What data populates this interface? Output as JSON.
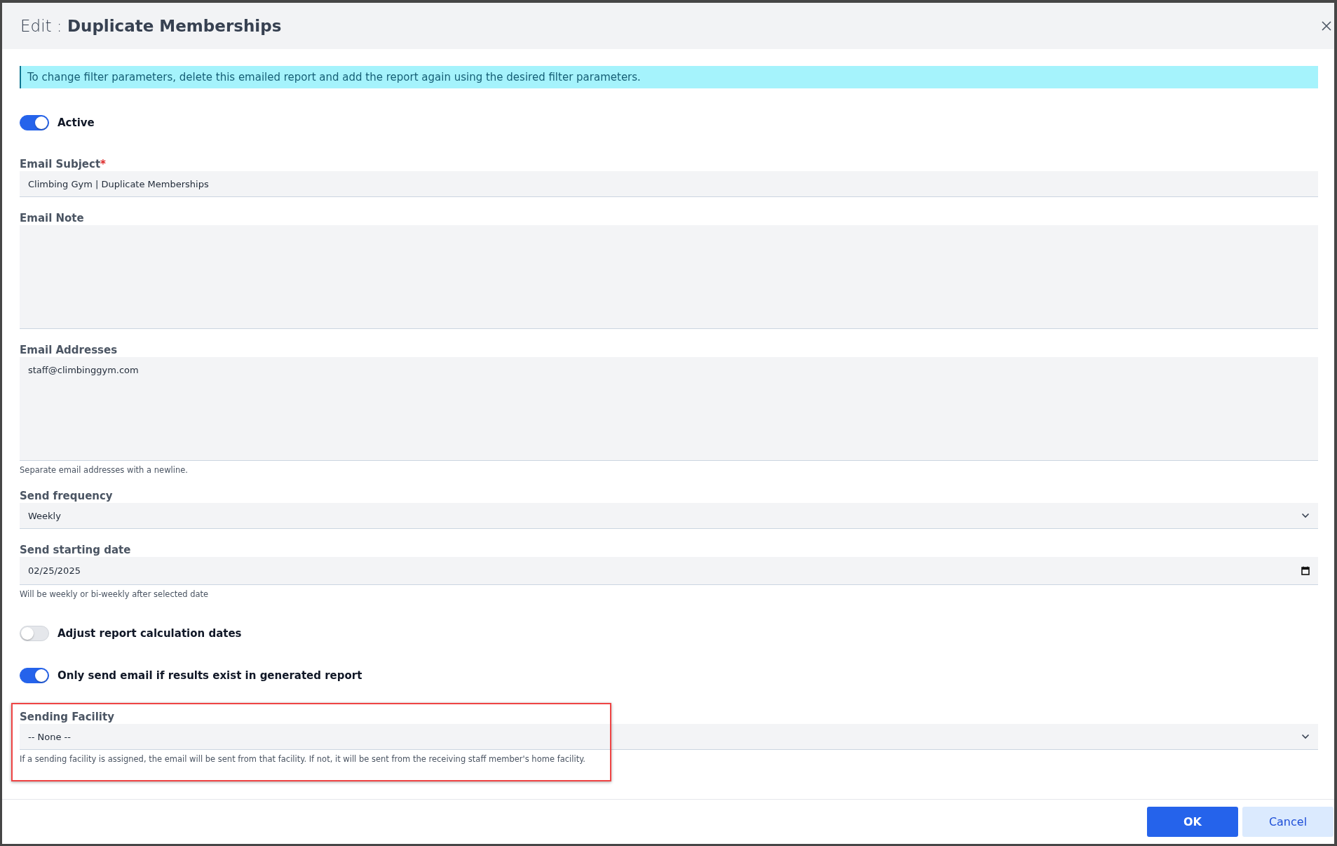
{
  "dialog": {
    "title": "Edit : **Duplicate Memberships**"
  },
  "notice": "To change filter parameters, delete this emailed report and add the report again using the desired filter parameters.",
  "fields": [
    {
      "kind": "toggle",
      "label": "Active",
      "on": true
    },
    {
      "kind": "text",
      "label": "Email Subject",
      "required_mark": "*",
      "value": "Climbing Gym | Duplicate Memberships"
    },
    {
      "kind": "textarea",
      "label": "Email Note"
    },
    {
      "kind": "textarea",
      "label": "Email Addresses",
      "value": "staff@climbinggym.com",
      "hint": "Separate email addresses with a newline."
    },
    {
      "kind": "select",
      "label": "Send frequency",
      "value": "Weekly"
    },
    {
      "kind": "date",
      "label": "Send starting date",
      "value": "02/25/2025",
      "hint": "Will be weekly or bi-weekly after selected date"
    },
    {
      "kind": "toggle",
      "label": "Adjust report calculation dates",
      "on": false
    },
    {
      "kind": "toggle",
      "label": "Only send email if results exist in generated report",
      "on": true
    },
    {
      "kind": "select",
      "label": "Sending Facility",
      "value": "-- None --",
      "hint": "If a sending facility is assigned, the email will be sent from that facility. If not, it will be sent from the receiving staff member's home facility.",
      "highlighted": true
    }
  ],
  "buttons": [
    {
      "kind": "primary",
      "label": "OK"
    },
    {
      "kind": "secondary",
      "label": "Cancel"
    }
  ]
}
